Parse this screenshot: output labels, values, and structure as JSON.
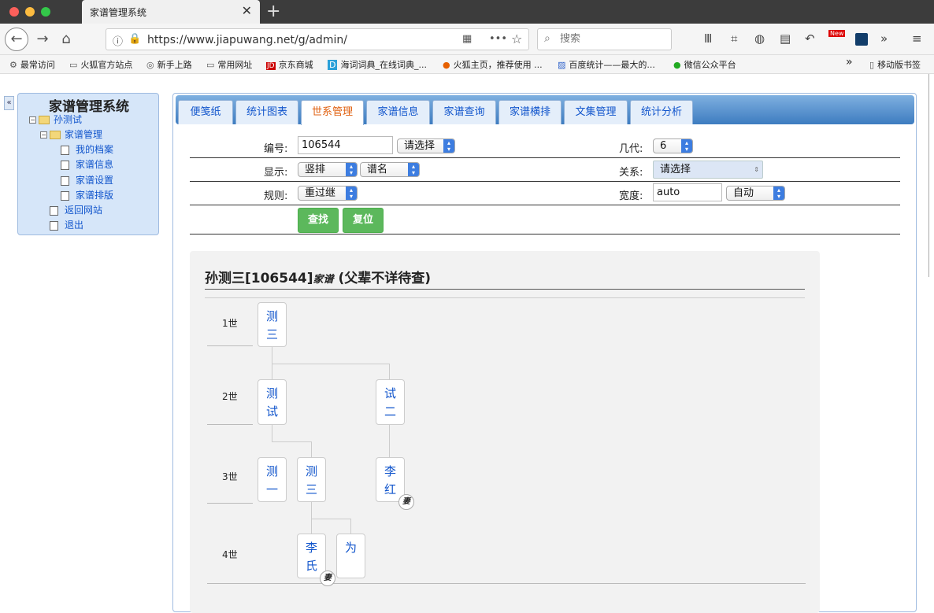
{
  "browser": {
    "tab_title": "家谱管理系统",
    "url": "https://www.jiapuwang.net/g/admin/",
    "search_placeholder": "搜索",
    "new_badge": "New",
    "bookmarks": [
      {
        "label": "最常访问",
        "icon": "gear-icon"
      },
      {
        "label": "火狐官方站点",
        "icon": "folder-icon"
      },
      {
        "label": "新手上路",
        "icon": "globe-icon"
      },
      {
        "label": "常用网址",
        "icon": "folder-icon"
      },
      {
        "label": "京东商城",
        "icon": "jd-icon"
      },
      {
        "label": "海词词典_在线词典_...",
        "icon": "dict-icon"
      },
      {
        "label": "火狐主页，推荐使用 ...",
        "icon": "firefox-icon"
      },
      {
        "label": "百度统计——最大的...",
        "icon": "chart-icon"
      },
      {
        "label": "微信公众平台",
        "icon": "wechat-icon"
      }
    ],
    "mobile_bookmarks": "移动版书签"
  },
  "sidebar": {
    "title": "家谱管理系统",
    "root": "孙测试",
    "group": "家谱管理",
    "items": [
      "我的档案",
      "家谱信息",
      "家谱设置",
      "家谱排版"
    ],
    "return": "返回网站",
    "logout": "退出",
    "collapse": "«"
  },
  "tabs": [
    {
      "label": "便笺纸",
      "active": false
    },
    {
      "label": "统计图表",
      "active": false
    },
    {
      "label": "世系管理",
      "active": true
    },
    {
      "label": "家谱信息",
      "active": false
    },
    {
      "label": "家谱查询",
      "active": false
    },
    {
      "label": "家谱横排",
      "active": false
    },
    {
      "label": "文集管理",
      "active": false
    },
    {
      "label": "统计分析",
      "active": false
    }
  ],
  "form": {
    "id_label": "编号:",
    "id_value": "106544",
    "id_select": "请选择",
    "gen_count_label": "几代:",
    "gen_count_value": "6",
    "display_label": "显示:",
    "display_value": "竖排",
    "display_name": "谱名",
    "relation_label": "关系:",
    "relation_value": "请选择",
    "rule_label": "规则:",
    "rule_value": "重过继",
    "width_label": "宽度:",
    "width_value": "auto",
    "width_select": "自动",
    "search_btn": "查找",
    "reset_btn": "复位"
  },
  "tree": {
    "title_name": "孙测三[106544]",
    "title_suffix": "家谱",
    "title_note": "(父辈不详待查)",
    "generations": [
      "1世",
      "2世",
      "3世",
      "4世"
    ],
    "nodes": {
      "g1": "测三",
      "g2a": "测试",
      "g2b": "试二",
      "g3a": "测一",
      "g3b": "测三",
      "g3c": "李红",
      "g4a": "李氏",
      "g4b": "为"
    },
    "wife_mark": "妻"
  }
}
